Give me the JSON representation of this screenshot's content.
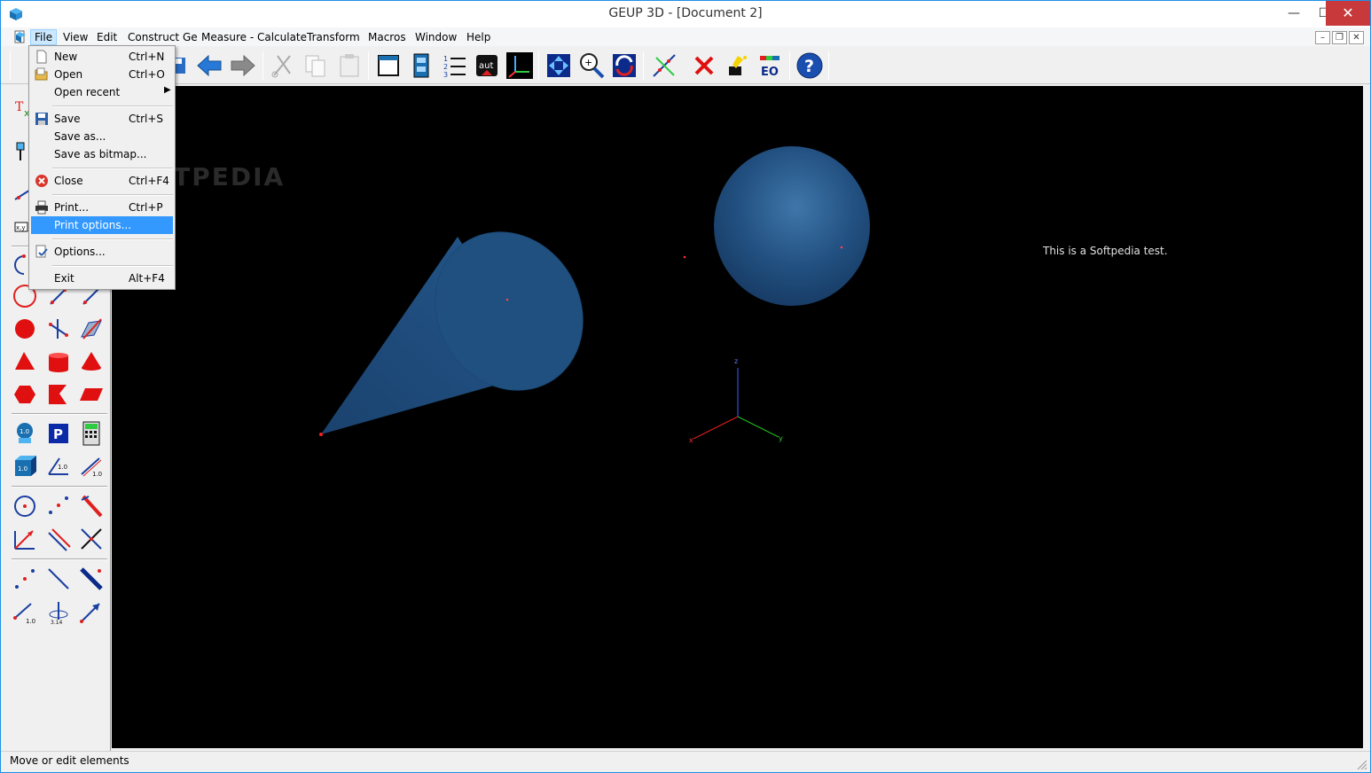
{
  "window": {
    "title": "GEUP 3D - [Document 2]"
  },
  "title_buttons": {
    "minimize": "—",
    "maximize": "☐",
    "close": "✕"
  },
  "menubar": {
    "items": [
      "File",
      "View",
      "Edit",
      "Construct Ge",
      "Measure - Calculate",
      "Transform",
      "Macros",
      "Window",
      "Help"
    ],
    "mdi": {
      "minimize": "–",
      "restore": "❐",
      "close": "✕"
    }
  },
  "file_menu": {
    "items": [
      {
        "label": "New",
        "shortcut": "Ctrl+N",
        "icon": "new-doc-icon"
      },
      {
        "label": "Open",
        "shortcut": "Ctrl+O",
        "icon": "open-folder-icon"
      },
      {
        "label": "Open recent",
        "shortcut": "",
        "submenu": true
      },
      {
        "label": "Save",
        "shortcut": "Ctrl+S",
        "icon": "floppy-icon"
      },
      {
        "label": "Save as...",
        "shortcut": ""
      },
      {
        "label": "Save as bitmap...",
        "shortcut": ""
      },
      {
        "label": "Close",
        "shortcut": "Ctrl+F4",
        "icon": "close-red-icon"
      },
      {
        "label": "Print...",
        "shortcut": "Ctrl+P",
        "icon": "printer-icon"
      },
      {
        "label": "Print options...",
        "shortcut": "",
        "highlighted": true
      },
      {
        "label": "Options...",
        "shortcut": "",
        "icon": "options-icon"
      },
      {
        "label": "Exit",
        "shortcut": "Alt+F4"
      }
    ]
  },
  "canvas": {
    "text": "This is a Softpedia test.",
    "watermark": "SOFTPEDIA",
    "axes": {
      "z": "z",
      "x": "x",
      "y": "y"
    }
  },
  "statusbar": {
    "text": "Move or edit elements"
  },
  "colors": {
    "accent": "#3399ff",
    "canvas_bg": "#000000",
    "solid": "#1f4f80",
    "point": "#ff2020"
  }
}
